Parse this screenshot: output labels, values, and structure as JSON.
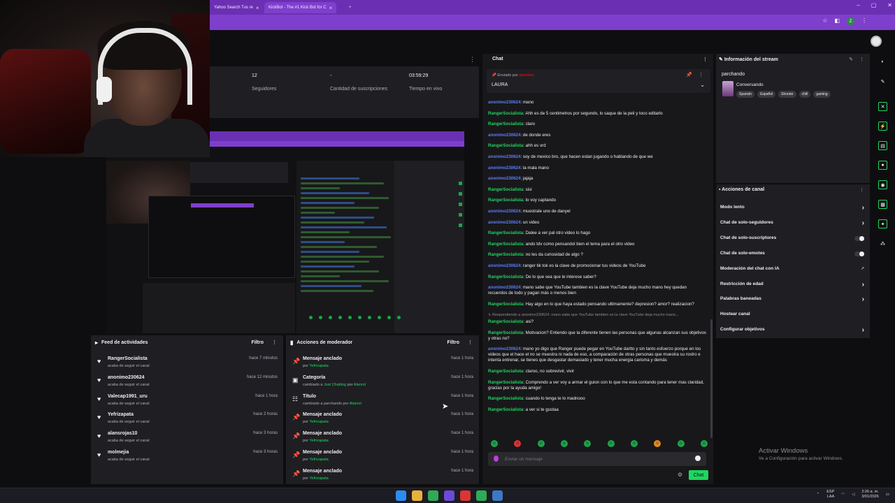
{
  "browser": {
    "tabs": [
      {
        "title": "Yahoo Search Tus re",
        "active": false
      },
      {
        "title": "KickBot - The #1 Kick Bot for C",
        "active": true
      }
    ],
    "new_tab": "+",
    "window_controls": [
      "–",
      "▢",
      "✕"
    ]
  },
  "stats": {
    "followers_value": "12",
    "followers_label": "Seguidores",
    "subs_value": "-",
    "subs_label": "Cantidad de suscripciones",
    "live_value": "03:59:29",
    "live_label": "Tiempo en vivo"
  },
  "activity_feed": {
    "title": "Feed de actividades",
    "filter": "Filtro",
    "items": [
      {
        "user": "RangerSocialista",
        "action": "acaba de seguir el canal",
        "time": "hace 7 minutos"
      },
      {
        "user": "anonimo230624",
        "action": "acaba de seguir el canal",
        "time": "hace 12 minutos"
      },
      {
        "user": "Valecap1991_uru",
        "action": "acaba de seguir el canal",
        "time": "hace 1 hora"
      },
      {
        "user": "Yefrizapata",
        "action": "acaba de seguir el canal",
        "time": "hace 2 horas"
      },
      {
        "user": "alansrojas10",
        "action": "acaba de seguir el canal",
        "time": "hace 3 horas"
      },
      {
        "user": "molmejia",
        "action": "acaba de seguir el canal",
        "time": "hace 3 horas"
      }
    ]
  },
  "mod_actions": {
    "title": "Acciones de moderador",
    "filter": "Filtro",
    "items": [
      {
        "title": "Mensaje anclado",
        "pre": "por",
        "highlight": "Yefrizapata",
        "mid": "",
        "highlight2": "",
        "time": "hace 1 hora",
        "icon": "pin-icon"
      },
      {
        "title": "Categoría",
        "pre": "cambiado a",
        "highlight": "Just Chatting",
        "mid": "por",
        "highlight2": "Alanrol",
        "time": "hace 1 hora",
        "icon": "category-icon"
      },
      {
        "title": "Título",
        "pre": "cambiado a",
        "highlight": "",
        "mid": "parchando por",
        "highlight2": "Alanrol",
        "time": "hace 1 hora",
        "icon": "title-icon"
      },
      {
        "title": "Mensaje anclado",
        "pre": "por",
        "highlight": "Yefrizapata",
        "mid": "",
        "highlight2": "",
        "time": "hace 1 hora",
        "icon": "pin-icon"
      },
      {
        "title": "Mensaje anclado",
        "pre": "por",
        "highlight": "Yefrizapata",
        "mid": "",
        "highlight2": "",
        "time": "hace 1 hora",
        "icon": "pin-icon"
      },
      {
        "title": "Mensaje anclado",
        "pre": "por",
        "highlight": "Yefrizapata",
        "mid": "",
        "highlight2": "",
        "time": "hace 1 hora",
        "icon": "pin-icon"
      },
      {
        "title": "Mensaje anclado",
        "pre": "por",
        "highlight": "Yefrizapata",
        "mid": "",
        "highlight2": "",
        "time": "hace 1 hora",
        "icon": "pin-icon"
      }
    ]
  },
  "chat": {
    "title": "Chat",
    "pinned_label": "Enviado por",
    "pinned_by": "anonimo",
    "pinned_text": "LAURA",
    "messages": [
      {
        "user": "anonimo230624",
        "color": "b",
        "text": "mano"
      },
      {
        "user": "RangerSocialista",
        "color": "g",
        "text": "Ahh es de 5 centimetros por segundo, lo saque de la peli y toco editarlo"
      },
      {
        "user": "RangerSocialista",
        "color": "g",
        "text": "claro"
      },
      {
        "user": "anonimo230624",
        "color": "b",
        "text": "de donde eres"
      },
      {
        "user": "RangerSocialista",
        "color": "g",
        "text": "ahh es vrd"
      },
      {
        "user": "anonimo230624",
        "color": "b",
        "text": "soy de mexico bro, que hacen estan jugando o hablando de que we"
      },
      {
        "user": "anonimo230624",
        "color": "b",
        "text": "la mala mano"
      },
      {
        "user": "anonimo230624",
        "color": "b",
        "text": "jajaja"
      },
      {
        "user": "RangerSocialista",
        "color": "g",
        "text": "sisi"
      },
      {
        "user": "RangerSocialista",
        "color": "g",
        "text": "lo voy captando"
      },
      {
        "user": "anonimo230624",
        "color": "b",
        "text": "muestrale uno de danyel"
      },
      {
        "user": "anonimo230624",
        "color": "b",
        "text": "un video"
      },
      {
        "user": "RangerSocialista",
        "color": "g",
        "text": "Dalee a ver pal otro video lo hago"
      },
      {
        "user": "RangerSocialista",
        "color": "g",
        "text": "ando tdv como pensandol bien el tema para el otro video"
      },
      {
        "user": "RangerSocialista",
        "color": "g",
        "text": "no les da curiosidad de algo ?"
      },
      {
        "user": "anonimo230624",
        "color": "b",
        "text": "ranger tik tok es la clave de promocionar tus videos de YouTube"
      },
      {
        "user": "RangerSocialista",
        "color": "g",
        "text": "De lo que sea que le interese saber?"
      },
      {
        "user": "anonimo230624",
        "color": "b",
        "text": "mano sabe que YouTube tambien es la clave YouTube deja mucho mano hey quedan recuerdos de todo y pagan más o menos bien"
      },
      {
        "user": "RangerSocialista",
        "color": "g",
        "text": "Hay algo en lo que haya estado pensando ultimamente? depresion? amor? realizacion?"
      },
      {
        "reply": true,
        "text": "↳ Respondiendo a anonimo230624: mano sabe que YouTube tambien es la clave YouTube deja mucho mano..."
      },
      {
        "user": "RangerSocialista",
        "color": "g",
        "text": "asi?"
      },
      {
        "user": "RangerSocialista",
        "color": "g",
        "text": "Motivacion? Entiendo que la diferente tienen las personas que algunas alcanzan sus objetivos y otras no?"
      },
      {
        "user": "anonimo230624",
        "color": "b",
        "text": "mano yo digo que Ranger puede pegar en YouTube dartto y sin tanto esfuerzo porque en los videos que el hace el no se muestra ni nada de eso, a comparación de otras personas que muestra su rostro e intenta entrenar, se tienes que desgastar demasiado y tener mucha energia carisma y demás"
      },
      {
        "user": "RangerSocialista",
        "color": "g",
        "text": "claroo, no sobrevivir, vivir"
      },
      {
        "user": "RangerSocialista",
        "color": "g",
        "text": "Comprendo a ver voy a armar el guion con lo que me esta contando para tener mas claridad, gracias por la ayuda amigo!"
      },
      {
        "user": "RangerSocialista",
        "color": "g",
        "text": "cuando lo tenga te lo madnooo"
      },
      {
        "user": "RangerSocialista",
        "color": "g",
        "text": "a ver si te gustaa"
      }
    ],
    "input_placeholder": "Enviar un mensaje",
    "send_label": "Chat"
  },
  "stream_info": {
    "title": "Información del stream",
    "stream_title": "parchando",
    "category": "Conversando",
    "tags": [
      "Spanish",
      "Español",
      "Shooter",
      "chill",
      "gaming"
    ]
  },
  "channel_actions": {
    "title": "Acciones de canal",
    "items": [
      {
        "label": "Modo lento",
        "control": "arrow"
      },
      {
        "label": "Chat de solo-seguidores",
        "control": "arrow"
      },
      {
        "label": "Chat de solo-suscriptores",
        "control": "toggle"
      },
      {
        "label": "Chat de solo-emotes",
        "control": "toggle"
      },
      {
        "label": "Moderación del chat con IA",
        "control": "external"
      },
      {
        "label": "Restricción de edad",
        "control": "arrow"
      },
      {
        "label": "Palabras baneadas",
        "control": "arrow"
      },
      {
        "label": "Hostear canal",
        "control": "none"
      },
      {
        "label": "Configurar objetivos",
        "control": "arrow"
      }
    ]
  },
  "activate_windows": {
    "title": "Activar Windows",
    "subtitle": "Ve a Configuración para activar Windows."
  },
  "taskbar": {
    "lang": "ESP",
    "lang2": "LAA",
    "time": "2:26 a. m.",
    "date": "3/01/2026"
  },
  "colors": {
    "kick_green": "#1ed760",
    "purple": "#7e3fcc",
    "panel": "#1f1f23"
  }
}
